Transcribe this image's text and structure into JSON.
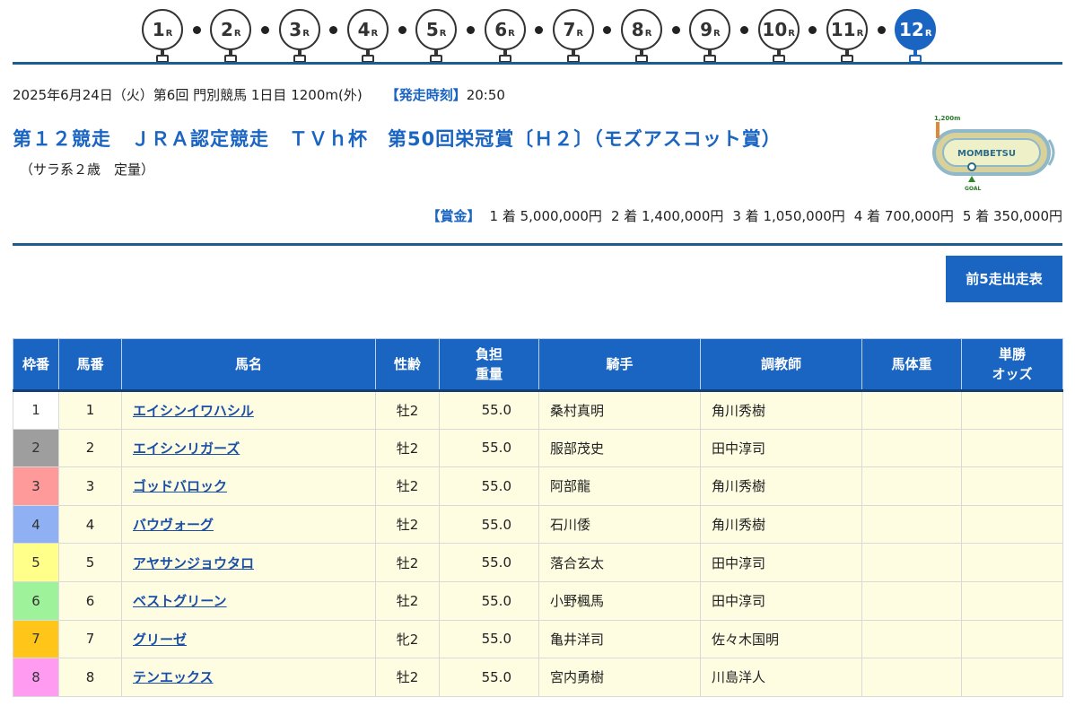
{
  "races": [
    {
      "num": "1",
      "suffix": "R"
    },
    {
      "num": "2",
      "suffix": "R"
    },
    {
      "num": "3",
      "suffix": "R"
    },
    {
      "num": "4",
      "suffix": "R"
    },
    {
      "num": "5",
      "suffix": "R"
    },
    {
      "num": "6",
      "suffix": "R"
    },
    {
      "num": "7",
      "suffix": "R"
    },
    {
      "num": "8",
      "suffix": "R"
    },
    {
      "num": "9",
      "suffix": "R"
    },
    {
      "num": "10",
      "suffix": "R"
    },
    {
      "num": "11",
      "suffix": "R"
    },
    {
      "num": "12",
      "suffix": "R"
    }
  ],
  "active_race": 12,
  "race_info": {
    "date_line": "2025年6月24日（火）第6回 門別競馬 1日目 1200m(外)",
    "start_label": "【発走時刻】",
    "start_time": "20:50",
    "title": "第１２競走　ＪＲＡ認定競走　ＴＶｈ杯　第50回栄冠賞〔Ｈ２〕（モズアスコット賞）",
    "conditions": "（サラ系２歳　定量）"
  },
  "course_map": {
    "distance_label": "1,200m",
    "track_name": "MOMBETSU",
    "goal_label": "GOAL"
  },
  "prize": {
    "label": "【賞金】",
    "items": [
      "1 着 5,000,000円",
      "2 着 1,400,000円",
      "3 着 1,050,000円",
      "4 着 700,000円",
      "5 着 350,000円"
    ]
  },
  "past_button_label": "前5走出走表",
  "table": {
    "headers": {
      "waku": "枠番",
      "umaban": "馬番",
      "name": "馬名",
      "sex_age": "性齢",
      "weight_1": "負担",
      "weight_2": "重量",
      "jockey": "騎手",
      "trainer": "調教師",
      "body_weight": "馬体重",
      "odds_1": "単勝",
      "odds_2": "オッズ"
    },
    "rows": [
      {
        "waku": "1",
        "umaban": "1",
        "name": "エイシンイワハシル",
        "sex_age": "牡2",
        "weight": "55.0",
        "jockey": "桑村真明",
        "trainer": "角川秀樹",
        "body_weight": "",
        "odds": ""
      },
      {
        "waku": "2",
        "umaban": "2",
        "name": "エイシンリガーズ",
        "sex_age": "牡2",
        "weight": "55.0",
        "jockey": "服部茂史",
        "trainer": "田中淳司",
        "body_weight": "",
        "odds": ""
      },
      {
        "waku": "3",
        "umaban": "3",
        "name": "ゴッドバロック",
        "sex_age": "牡2",
        "weight": "55.0",
        "jockey": "阿部龍",
        "trainer": "角川秀樹",
        "body_weight": "",
        "odds": ""
      },
      {
        "waku": "4",
        "umaban": "4",
        "name": "バウヴォーグ",
        "sex_age": "牡2",
        "weight": "55.0",
        "jockey": "石川倭",
        "trainer": "角川秀樹",
        "body_weight": "",
        "odds": ""
      },
      {
        "waku": "5",
        "umaban": "5",
        "name": "アヤサンジョウタロ",
        "sex_age": "牡2",
        "weight": "55.0",
        "jockey": "落合玄太",
        "trainer": "田中淳司",
        "body_weight": "",
        "odds": ""
      },
      {
        "waku": "6",
        "umaban": "6",
        "name": "ベストグリーン",
        "sex_age": "牡2",
        "weight": "55.0",
        "jockey": "小野楓馬",
        "trainer": "田中淳司",
        "body_weight": "",
        "odds": ""
      },
      {
        "waku": "7",
        "umaban": "7",
        "name": "グリーゼ",
        "sex_age": "牝2",
        "weight": "55.0",
        "jockey": "亀井洋司",
        "trainer": "佐々木国明",
        "body_weight": "",
        "odds": ""
      },
      {
        "waku": "8",
        "umaban": "8",
        "name": "テンエックス",
        "sex_age": "牡2",
        "weight": "55.0",
        "jockey": "宮内勇樹",
        "trainer": "川島洋人",
        "body_weight": "",
        "odds": ""
      }
    ]
  },
  "waku_colors": {
    "1": {
      "bg": "#ffffff",
      "fg": "#333333"
    },
    "2": {
      "bg": "#9e9e9e",
      "fg": "#333333"
    },
    "3": {
      "bg": "#ff9a9a",
      "fg": "#333333"
    },
    "4": {
      "bg": "#8fb0f2",
      "fg": "#333333"
    },
    "5": {
      "bg": "#ffff8a",
      "fg": "#333333"
    },
    "6": {
      "bg": "#9df29a",
      "fg": "#333333"
    },
    "7": {
      "bg": "#ffc619",
      "fg": "#333333"
    },
    "8": {
      "bg": "#ff9cf2",
      "fg": "#333333"
    }
  },
  "colors": {
    "accent": "#1a64c2",
    "rule": "#1d5c8e",
    "row_bg": "#fefde1"
  }
}
